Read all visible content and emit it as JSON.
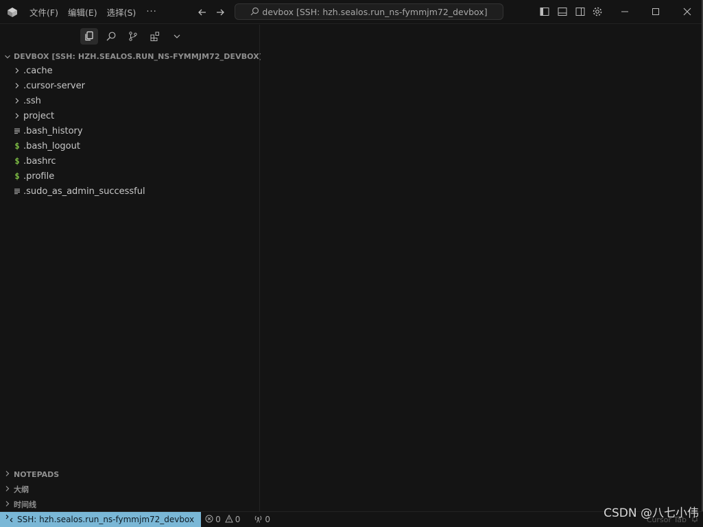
{
  "menubar": {
    "items": [
      "文件(F)",
      "编辑(E)",
      "选择(S)"
    ],
    "more": "···"
  },
  "command_center": {
    "text": "devbox [SSH: hzh.sealos.run_ns-fymmjm72_devbox]"
  },
  "explorer": {
    "header": "DEVBOX [SSH: HZH.SEALOS.RUN_NS-FYMMJM72_DEVBOX]",
    "items": [
      {
        "label": ".cache",
        "kind": "folder",
        "icon": "chevron-right-icon"
      },
      {
        "label": ".cursor-server",
        "kind": "folder",
        "icon": "chevron-right-icon"
      },
      {
        "label": ".ssh",
        "kind": "folder",
        "icon": "chevron-right-icon"
      },
      {
        "label": "project",
        "kind": "folder",
        "icon": "chevron-right-icon"
      },
      {
        "label": ".bash_history",
        "kind": "file",
        "icon": "text-file-icon"
      },
      {
        "label": ".bash_logout",
        "kind": "shell",
        "icon": "shell-dollar-icon"
      },
      {
        "label": ".bashrc",
        "kind": "shell",
        "icon": "shell-dollar-icon"
      },
      {
        "label": ".profile",
        "kind": "shell",
        "icon": "shell-dollar-icon"
      },
      {
        "label": ".sudo_as_admin_successful",
        "kind": "file",
        "icon": "text-file-icon"
      }
    ]
  },
  "sections": {
    "notepads": "NOTEPADS",
    "outline": "大纲",
    "timeline": "时间线"
  },
  "statusbar": {
    "remote": "SSH: hzh.sealos.run_ns-fymmjm72_devbox",
    "errors": "0",
    "warnings": "0",
    "ports": "0",
    "cursor_tab": "Cursor Tab"
  },
  "watermark": "CSDN @八七小伟",
  "colors": {
    "background": "#141414",
    "remote_indicator": "#7ab7d6",
    "shell_icon": "#7fbf45"
  }
}
